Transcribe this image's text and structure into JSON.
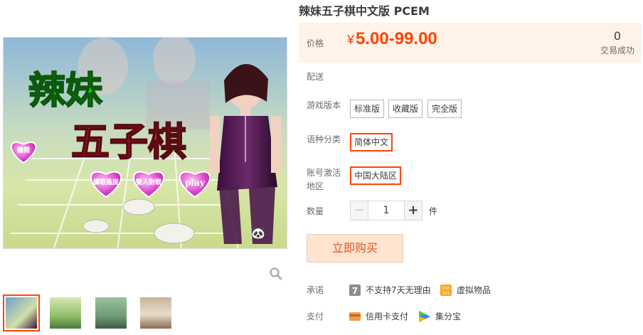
{
  "product": {
    "title": "辣妹五子棋中文版 PCEM"
  },
  "price": {
    "label": "价格",
    "currency": "¥",
    "value": "5.00-99.00"
  },
  "deals": {
    "count": "0",
    "label": "交易成功"
  },
  "shipping": {
    "label": "配送"
  },
  "edition": {
    "label": "游戏版本",
    "options": [
      "标准版",
      "收藏版",
      "完全版"
    ]
  },
  "language": {
    "label": "语种分类",
    "selected": "简体中文"
  },
  "region": {
    "label_line1": "账号激活",
    "label_line2": "地区",
    "selected": "中国大陆区"
  },
  "quantity": {
    "label": "数量",
    "minus": "−",
    "value": "1",
    "plus": "+",
    "unit": "件"
  },
  "buy": {
    "label": "立即购买"
  },
  "promise": {
    "label": "承诺",
    "items": [
      {
        "icon": "seven-day-icon",
        "text": "不支持7天无理由"
      },
      {
        "icon": "virtual-goods-icon",
        "text": "虚拟物品"
      }
    ]
  },
  "payment": {
    "label": "支付",
    "items": [
      {
        "icon": "credit-card-icon",
        "text": "信用卡支付"
      },
      {
        "icon": "jifenbao-icon",
        "text": "集分宝"
      }
    ]
  },
  "game_art": {
    "logo_line1": "辣妹",
    "logo_line2": "五子棋",
    "hearts": [
      "離開",
      "讀取進度",
      "雙人對戰",
      "play"
    ]
  },
  "colors": {
    "accent": "#ff4400",
    "price_bg": "#fff2e8",
    "buy_bg": "#ffe4d0"
  }
}
